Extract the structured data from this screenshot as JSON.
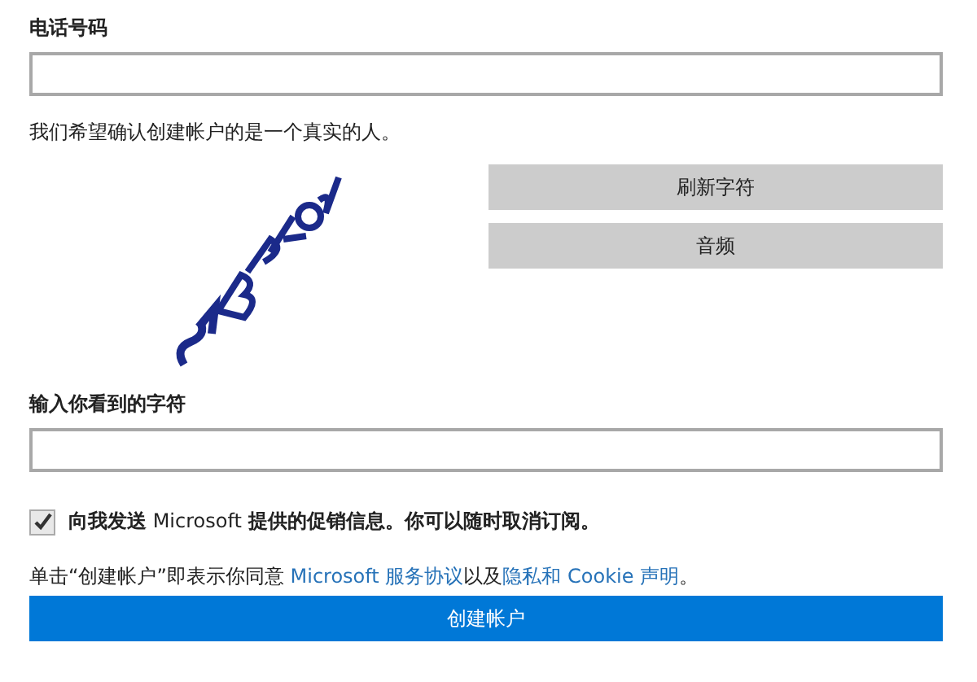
{
  "phone": {
    "label": "电话号码"
  },
  "captcha": {
    "intro": "我们希望确认创建帐户的是一个真实的人。",
    "buttons": [
      "刷新字符",
      "音频"
    ],
    "label": "输入你看到的字符"
  },
  "promo": {
    "checked": true,
    "label": "**向我发送** Microsoft **提供的促销信息。你可以随时取消订阅。**"
  },
  "agreement": [
    {
      "kind": "text",
      "text": "单击“创建帐户”即表示你同意 "
    },
    {
      "kind": "link",
      "text": "Microsoft 服务协议"
    },
    {
      "kind": "text",
      "text": "以及"
    },
    {
      "kind": "link",
      "text": "隐私和 Cookie 声明"
    },
    {
      "kind": "text",
      "text": "。"
    }
  ],
  "submit": "创建帐户"
}
